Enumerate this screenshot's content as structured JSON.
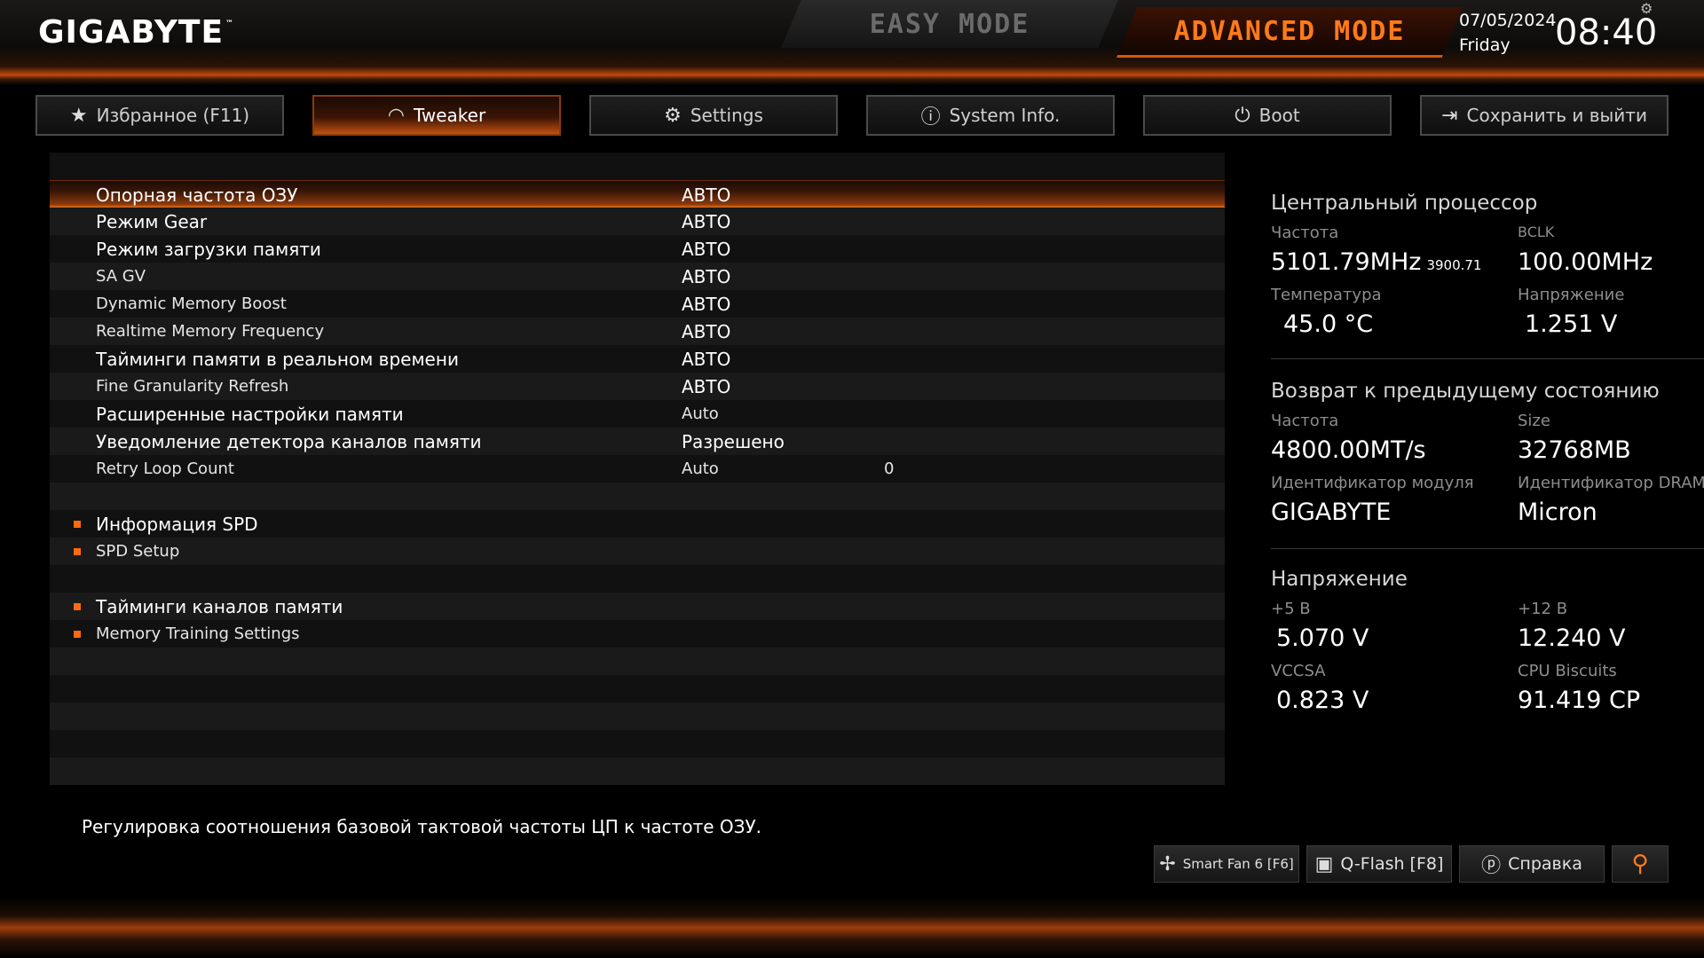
{
  "header": {
    "brand": "GIGABYTE",
    "brand_tm": "™",
    "easy_mode": "EASY MODE",
    "advanced_mode": "ADVANCED MODE",
    "date": "07/05/2024",
    "day": "Friday",
    "time": "08:40"
  },
  "tabs": [
    {
      "label": "Избранное (F11)",
      "icon": "star-folder-icon"
    },
    {
      "label": "Tweaker",
      "icon": "speedometer-icon",
      "active": true
    },
    {
      "label": "Settings",
      "icon": "gear-icon"
    },
    {
      "label": "System Info.",
      "icon": "info-icon"
    },
    {
      "label": "Boot",
      "icon": "power-icon"
    },
    {
      "label": "Сохранить и выйти",
      "icon": "exit-icon"
    }
  ],
  "settings": [
    {
      "label": "Опорная частота ОЗУ",
      "value": "АВТО"
    },
    {
      "label": "Режим Gear",
      "value": "АВТО"
    },
    {
      "label": "Режим загрузки памяти",
      "value": "АВТО"
    },
    {
      "label": "SA GV",
      "value": "АВТО"
    },
    {
      "label": "Dynamic Memory Boost",
      "value": "АВТО"
    },
    {
      "label": "Realtime Memory Frequency",
      "value": "АВТО"
    },
    {
      "label": "Тайминги памяти в реальном времени",
      "value": "АВТО"
    },
    {
      "label": "Fine Granularity Refresh",
      "value": "АВТО"
    },
    {
      "label": "Расширенные настройки памяти",
      "value": "Auto"
    },
    {
      "label": "Уведомление детектора каналов памяти",
      "value": "Разрешено"
    },
    {
      "label": "Retry Loop Count",
      "value": "Auto",
      "value2": "0"
    }
  ],
  "submenus": [
    {
      "label": "Информация SPD"
    },
    {
      "label": "SPD Setup"
    },
    {
      "label": "Тайминги каналов памяти"
    },
    {
      "label": "Memory Training Settings"
    }
  ],
  "info": {
    "cpu": {
      "title": "Центральный процессор",
      "freq_label": "Частота",
      "freq_value": "5101.79MHz",
      "freq_sub": "3900.71",
      "bclk_label": "BCLK",
      "bclk_value": "100.00MHz",
      "temp_label": "Температура",
      "temp_value": "45.0 °C",
      "volt_label": "Напряжение",
      "volt_value": "1.251 V"
    },
    "memory": {
      "title": "Возврат к предыдущему состоянию",
      "freq_label": "Частота",
      "freq_value": "4800.00MT/s",
      "size_label": "Size",
      "size_value": "32768MB",
      "module_label": "Идентификатор модуля",
      "module_value": "GIGABYTE",
      "dram_label": "Идентификатор DRAM",
      "dram_value": "Micron"
    },
    "voltage": {
      "title": "Напряжение",
      "v5_label": "+5 В",
      "v5_value": "5.070 V",
      "v12_label": "+12 В",
      "v12_value": "12.240 V",
      "vccsa_label": "VCCSA",
      "vccsa_value": "0.823 V",
      "biscuits_label": "CPU Biscuits",
      "biscuits_value": "91.419 CP"
    }
  },
  "footer": {
    "help_text": "Регулировка соотношения базовой тактовой частоты ЦП к частоте ОЗУ.",
    "smartfan": "Smart Fan 6 [F6]",
    "qflash": "Q-Flash [F8]",
    "help": "Справка"
  },
  "colors": {
    "accent": "#ff7a1a",
    "accent_dark": "#8a3a0c",
    "panel": "#141414"
  }
}
